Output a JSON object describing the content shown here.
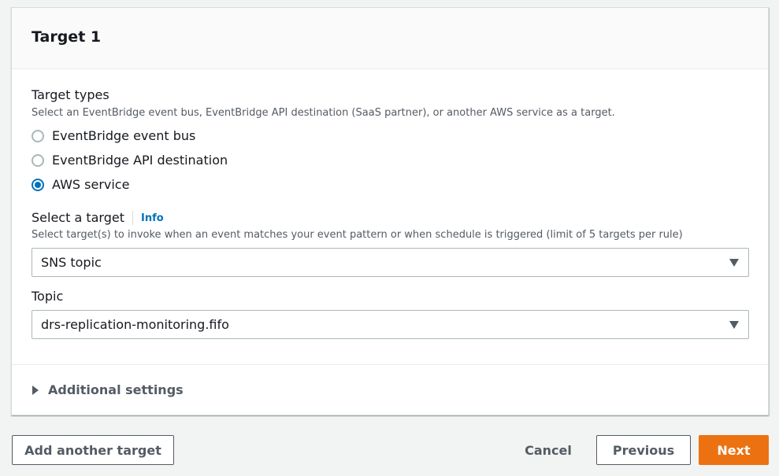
{
  "panel": {
    "title": "Target 1"
  },
  "target_types": {
    "label": "Target types",
    "description": "Select an EventBridge event bus, EventBridge API destination (SaaS partner), or another AWS service as a target.",
    "options": [
      {
        "label": "EventBridge event bus",
        "checked": false
      },
      {
        "label": "EventBridge API destination",
        "checked": false
      },
      {
        "label": "AWS service",
        "checked": true
      }
    ]
  },
  "select_target": {
    "label": "Select a target",
    "info": "Info",
    "description": "Select target(s) to invoke when an event matches your event pattern or when schedule is triggered (limit of 5 targets per rule)",
    "value": "SNS topic"
  },
  "topic": {
    "label": "Topic",
    "value": "drs-replication-monitoring.fifo"
  },
  "additional_settings": {
    "label": "Additional settings"
  },
  "footer": {
    "add_target": "Add another target",
    "cancel": "Cancel",
    "previous": "Previous",
    "next": "Next"
  },
  "colors": {
    "accent": "#0073bb",
    "primary_button": "#ec7211"
  },
  "icons": {
    "select_caret": "caret-down-icon",
    "expander": "caret-right-icon"
  }
}
